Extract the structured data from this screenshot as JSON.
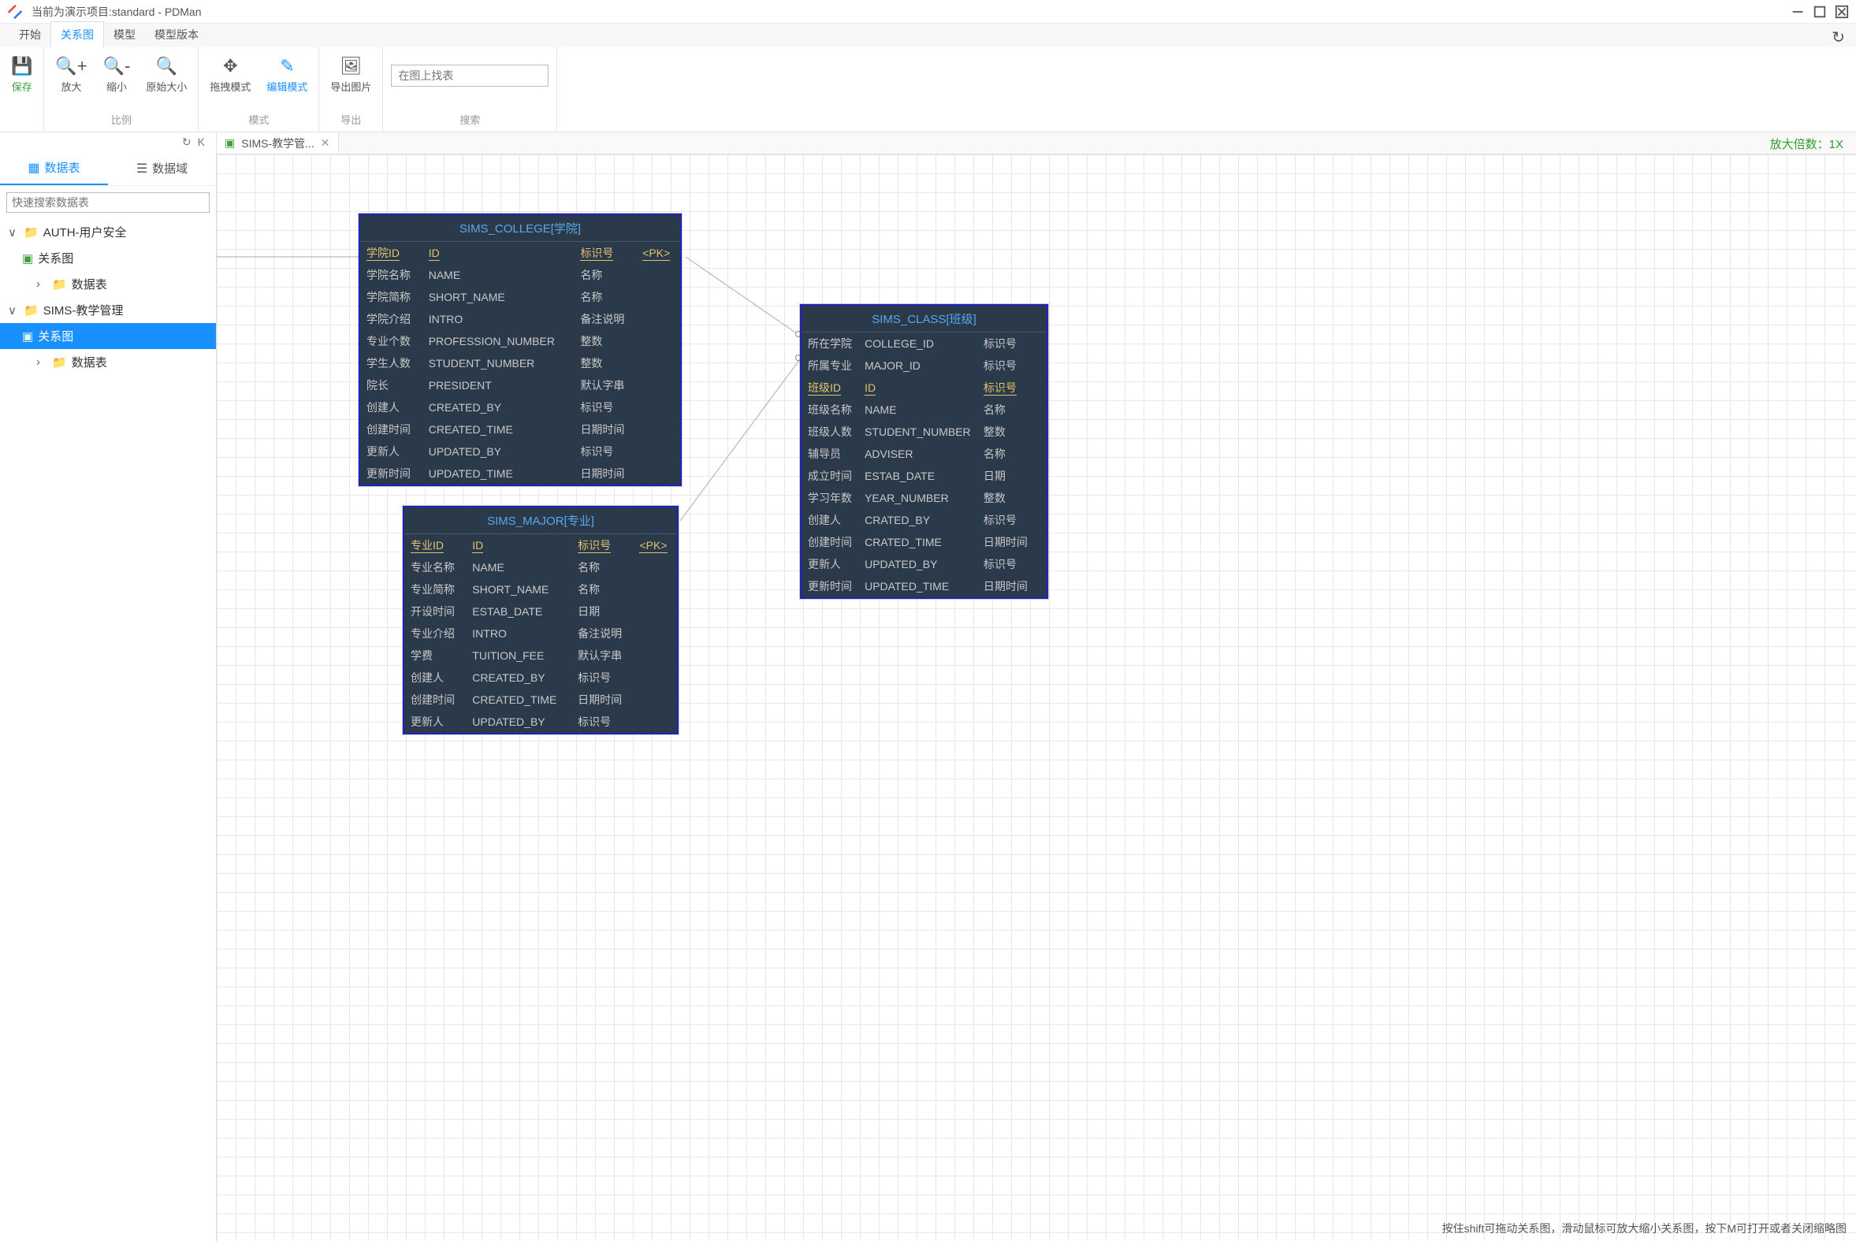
{
  "window": {
    "title": "当前为演示项目:standard - PDMan"
  },
  "menutabs": {
    "items": [
      "开始",
      "关系图",
      "模型",
      "模型版本"
    ],
    "active": 1
  },
  "ribbon": {
    "save": "保存",
    "scale": {
      "zoom_in": "放大",
      "zoom_out": "缩小",
      "reset": "原始大小",
      "group": "比例"
    },
    "mode": {
      "drag": "拖拽模式",
      "edit": "编辑模式",
      "group": "模式"
    },
    "export": {
      "img": "导出图片",
      "group": "导出"
    },
    "search": {
      "placeholder": "在图上找表",
      "group": "搜索"
    }
  },
  "sidebar": {
    "tabs": {
      "tables": "数据表",
      "domains": "数据域"
    },
    "search_placeholder": "快速搜索数据表",
    "tree": {
      "n0": {
        "label": "AUTH-用户安全"
      },
      "n0a": {
        "label": "关系图"
      },
      "n0b": {
        "label": "数据表"
      },
      "n1": {
        "label": "SIMS-教学管理"
      },
      "n1a": {
        "label": "关系图"
      },
      "n1b": {
        "label": "数据表"
      }
    }
  },
  "canvas": {
    "tab": "SIMS-教学管...",
    "zoom": "放大倍数：1X",
    "hint": "按住shift可拖动关系图，滑动鼠标可放大缩小关系图，按下M可打开或者关闭缩略图"
  },
  "entities": {
    "college": {
      "title": "SIMS_COLLEGE[学院]",
      "rows": [
        {
          "c": "学院ID",
          "f": "ID",
          "t": "标识号",
          "k": "<PK>",
          "pk": true
        },
        {
          "c": "学院名称",
          "f": "NAME",
          "t": "名称"
        },
        {
          "c": "学院简称",
          "f": "SHORT_NAME",
          "t": "名称"
        },
        {
          "c": "学院介绍",
          "f": "INTRO",
          "t": "备注说明"
        },
        {
          "c": "专业个数",
          "f": "PROFESSION_NUMBER",
          "t": "整数"
        },
        {
          "c": "学生人数",
          "f": "STUDENT_NUMBER",
          "t": "整数"
        },
        {
          "c": "院长",
          "f": "PRESIDENT",
          "t": "默认字串"
        },
        {
          "c": "创建人",
          "f": "CREATED_BY",
          "t": "标识号"
        },
        {
          "c": "创建时间",
          "f": "CREATED_TIME",
          "t": "日期时间"
        },
        {
          "c": "更新人",
          "f": "UPDATED_BY",
          "t": "标识号"
        },
        {
          "c": "更新时间",
          "f": "UPDATED_TIME",
          "t": "日期时间"
        }
      ]
    },
    "major": {
      "title": "SIMS_MAJOR[专业]",
      "rows": [
        {
          "c": "专业ID",
          "f": "ID",
          "t": "标识号",
          "k": "<PK>",
          "pk": true
        },
        {
          "c": "专业名称",
          "f": "NAME",
          "t": "名称"
        },
        {
          "c": "专业简称",
          "f": "SHORT_NAME",
          "t": "名称"
        },
        {
          "c": "开设时间",
          "f": "ESTAB_DATE",
          "t": "日期"
        },
        {
          "c": "专业介绍",
          "f": "INTRO",
          "t": "备注说明"
        },
        {
          "c": "学费",
          "f": "TUITION_FEE",
          "t": "默认字串"
        },
        {
          "c": "创建人",
          "f": "CREATED_BY",
          "t": "标识号"
        },
        {
          "c": "创建时间",
          "f": "CREATED_TIME",
          "t": "日期时间"
        },
        {
          "c": "更新人",
          "f": "UPDATED_BY",
          "t": "标识号"
        }
      ]
    },
    "class": {
      "title": "SIMS_CLASS[班级]",
      "rows": [
        {
          "c": "所在学院",
          "f": "COLLEGE_ID",
          "t": "标识号"
        },
        {
          "c": "所属专业",
          "f": "MAJOR_ID",
          "t": "标识号"
        },
        {
          "c": "班级ID",
          "f": "ID",
          "t": "标识号",
          "pk": true
        },
        {
          "c": "班级名称",
          "f": "NAME",
          "t": "名称"
        },
        {
          "c": "班级人数",
          "f": "STUDENT_NUMBER",
          "t": "整数"
        },
        {
          "c": "辅导员",
          "f": "ADVISER",
          "t": "名称"
        },
        {
          "c": "成立时间",
          "f": "ESTAB_DATE",
          "t": "日期"
        },
        {
          "c": "学习年数",
          "f": "YEAR_NUMBER",
          "t": "整数"
        },
        {
          "c": "创建人",
          "f": "CRATED_BY",
          "t": "标识号"
        },
        {
          "c": "创建时间",
          "f": "CRATED_TIME",
          "t": "日期时间"
        },
        {
          "c": "更新人",
          "f": "UPDATED_BY",
          "t": "标识号"
        },
        {
          "c": "更新时间",
          "f": "UPDATED_TIME",
          "t": "日期时间"
        }
      ]
    }
  }
}
